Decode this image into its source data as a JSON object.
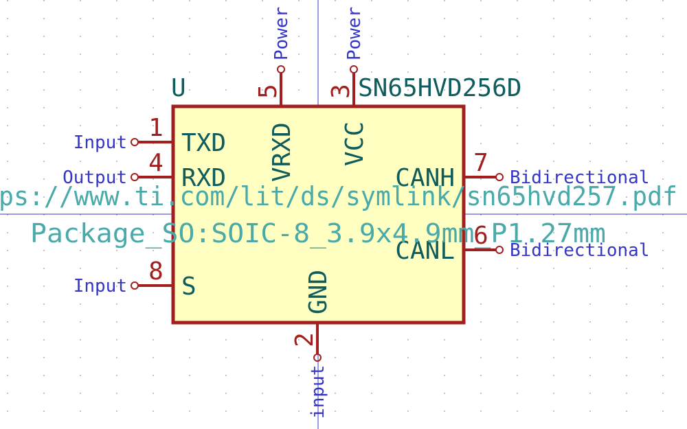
{
  "symbol": {
    "reference": "U",
    "value": "SN65HVD256D",
    "datasheet": "ps://www.ti.com/lit/ds/symlink/sn65hvd257.pdf",
    "footprint": "Package_SO:SOIC-8_3.9x4.9mm_P1.27mm"
  },
  "pins": [
    {
      "number": "1",
      "name": "TXD",
      "type": "Input",
      "side": "left"
    },
    {
      "number": "4",
      "name": "RXD",
      "type": "Output",
      "side": "left"
    },
    {
      "number": "8",
      "name": "S",
      "type": "Input",
      "side": "left"
    },
    {
      "number": "7",
      "name": "CANH",
      "type": "Bidirectional",
      "side": "right"
    },
    {
      "number": "6",
      "name": "CANL",
      "type": "Bidirectional",
      "side": "right"
    },
    {
      "number": "5",
      "name": "VRXD",
      "type": "Power",
      "side": "top"
    },
    {
      "number": "3",
      "name": "VCC",
      "type": "Power",
      "side": "top"
    },
    {
      "number": "2",
      "name": "GND",
      "type": "input",
      "side": "bottom"
    }
  ],
  "colors": {
    "body_fill": "#ffffc2",
    "outline": "#a11f1f",
    "pin_name": "#0f5c5c",
    "pin_type": "#3535c8",
    "hidden_field": "#4aa9a9"
  }
}
